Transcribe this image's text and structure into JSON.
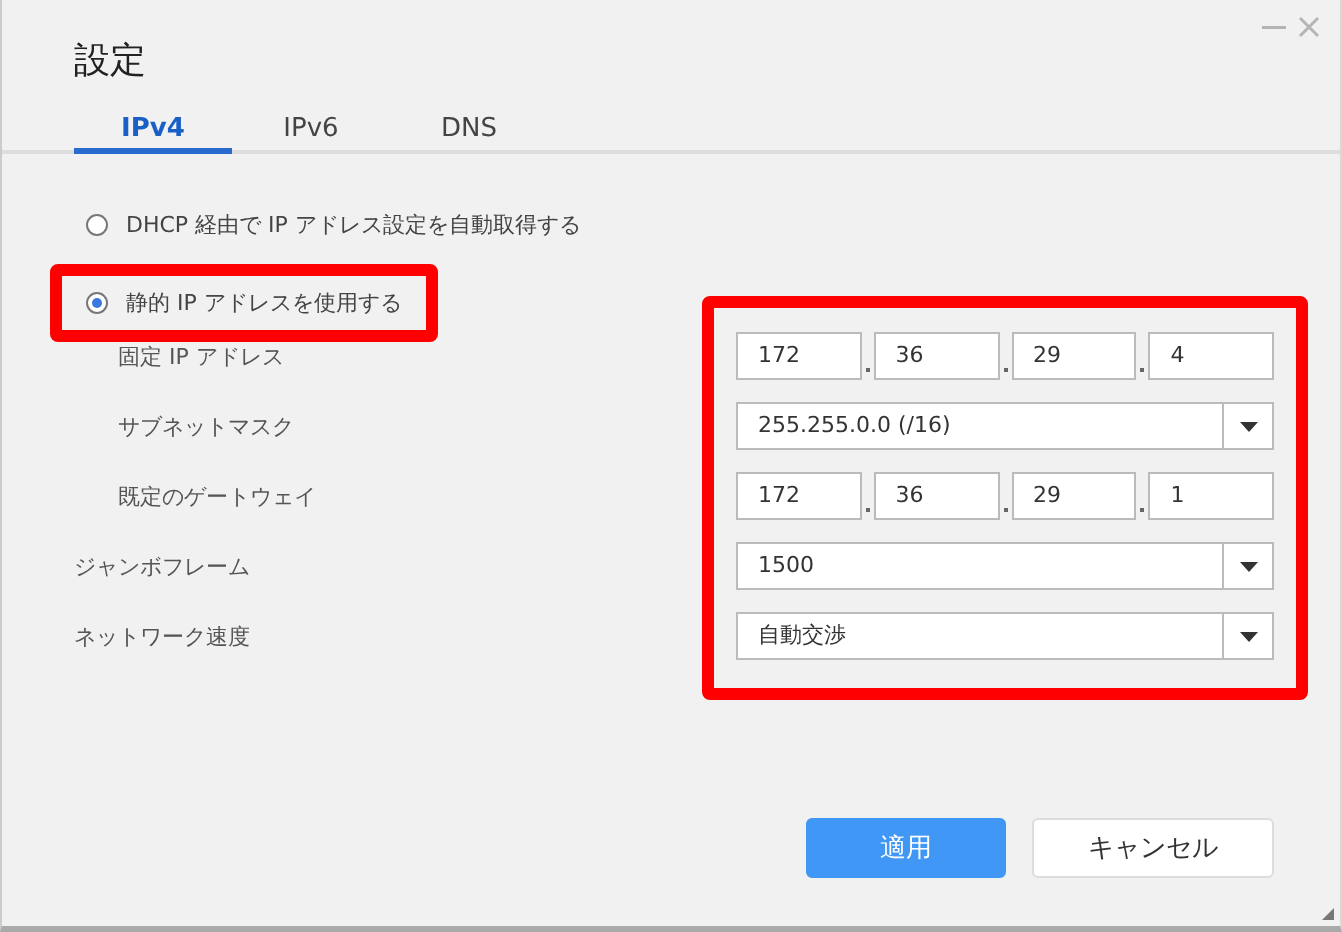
{
  "window": {
    "title": "設定"
  },
  "tabs": [
    {
      "label": "IPv4",
      "selected": true
    },
    {
      "label": "IPv6",
      "selected": false
    },
    {
      "label": "DNS",
      "selected": false
    }
  ],
  "radios": [
    {
      "label": "DHCP 経由で IP アドレス設定を自動取得する",
      "selected": false,
      "highlighted": false
    },
    {
      "label": "静的 IP アドレスを使用する",
      "selected": true,
      "highlighted": true
    }
  ],
  "fields_highlighted": true,
  "fields": [
    {
      "label": "固定 IP アドレス",
      "sub": true,
      "kind": "ip",
      "octets": [
        "172",
        "36",
        "29",
        "4"
      ]
    },
    {
      "label": "サブネットマスク",
      "sub": true,
      "kind": "select",
      "value": "255.255.0.0 (/16)"
    },
    {
      "label": "既定のゲートウェイ",
      "sub": true,
      "kind": "ip",
      "octets": [
        "172",
        "36",
        "29",
        "1"
      ]
    },
    {
      "label": "ジャンボフレーム",
      "sub": false,
      "kind": "select",
      "value": "1500"
    },
    {
      "label": "ネットワーク速度",
      "sub": false,
      "kind": "select",
      "value": "自動交渉"
    }
  ],
  "buttons": [
    {
      "label": "適用",
      "primary": true
    },
    {
      "label": "キャンセル",
      "primary": false
    }
  ]
}
